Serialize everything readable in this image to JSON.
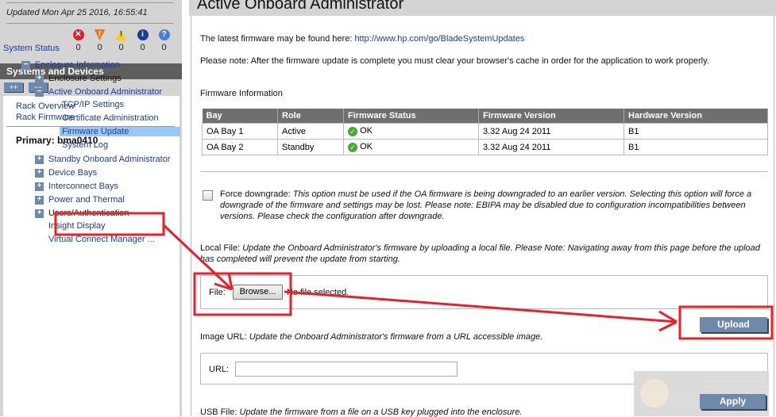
{
  "status": {
    "updated": "Updated Mon Apr 25 2016, 16:55:41",
    "label": "System Status",
    "counts": [
      {
        "icon": "critical-icon",
        "value": "0",
        "color": "#e0202a",
        "glyph": "✕"
      },
      {
        "icon": "major-icon",
        "value": "0",
        "color": "#e87a20",
        "glyph": "!"
      },
      {
        "icon": "warning-icon",
        "value": "0",
        "color": "#f4d020",
        "glyph": "!"
      },
      {
        "icon": "info-icon",
        "value": "0",
        "color": "#1a3d99",
        "glyph": "i"
      },
      {
        "icon": "unknown-icon",
        "value": "0",
        "color": "#4a80d0",
        "glyph": "?"
      }
    ]
  },
  "sidebar": {
    "header": "Systems and Devices",
    "expand": "++",
    "collapse": "−−",
    "rack_overview": "Rack Overview",
    "rack_firmware": "Rack Firmware",
    "primary": "Primary: bma0410",
    "items": [
      "Enclosure Information",
      "Enclosure Settings",
      "Active Onboard Administrator",
      "TCP/IP Settings",
      "Certificate Administration",
      "Firmware Update",
      "System Log",
      "Standby Onboard Administrator",
      "Device Bays",
      "Interconnect Bays",
      "Power and Thermal",
      "Users/Authentication",
      "Insight Display",
      "Virtual Connect Manager ..."
    ]
  },
  "main": {
    "title": "Active Onboard Administrator",
    "latest": "The latest firmware may be found here: ",
    "latest_link": "http://www.hp.com/go/BladeSystemUpdates",
    "note": "Please note: After the firmware update is complete you must clear your browser's cache in order for the application to work properly.",
    "fw_info": "Firmware Information",
    "columns": [
      "Bay",
      "Role",
      "Firmware Status",
      "Firmware Version",
      "Hardware Version"
    ],
    "rows": [
      [
        "OA Bay 1",
        "Active",
        "OK",
        "3.32 Aug 24 2011",
        "B1"
      ],
      [
        "OA Bay 2",
        "Standby",
        "OK",
        "3.32 Aug 24 2011",
        "B1"
      ]
    ],
    "force_label": "Force downgrade: ",
    "force_text1": "This option must be used if the OA firmware is being downgraded to an earlier version. Selecting this option will force a",
    "force_text2": "downgrade of the firmware and settings may be lost. Please note: EBIPA may be disabled due to configuration incompatibilities between",
    "force_text3": "versions. Please check the configuration after downgrade.",
    "local_label": "Local File: ",
    "local_text1": "Update the Onboard Administrator's firmware by uploading a local file.  Please Note: Navigating away from this page before the upload",
    "local_text2": "has completed will prevent the update from starting.",
    "file_label": "File:",
    "browse": "Browse...",
    "no_file": "No file selected.",
    "upload": "Upload",
    "image_label": "Image URL: ",
    "image_text": "Update the Onboard Administrator's firmware from a URL accessible image.",
    "url_label": "URL:",
    "url_value": "",
    "apply": "Apply",
    "usb_label": "USB File: ",
    "usb_text": "Update the firmware from a file on a USB key plugged into the enclosure."
  }
}
